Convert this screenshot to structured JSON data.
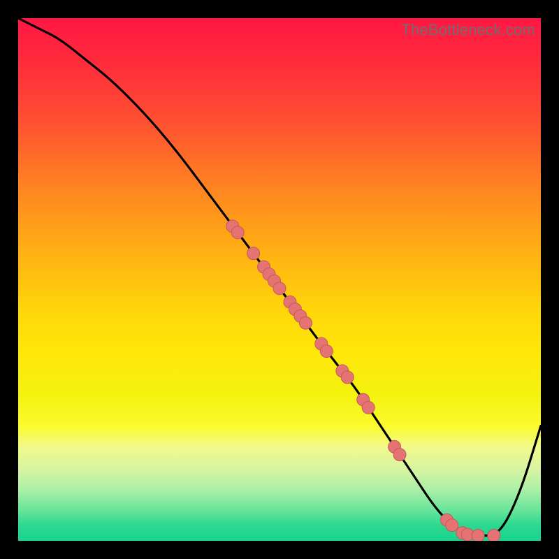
{
  "watermark": "TheBottleneck.com",
  "colors": {
    "curve_stroke": "#000000",
    "dot_fill": "#e57373",
    "dot_stroke": "#c25a5a"
  },
  "chart_data": {
    "type": "line",
    "title": "",
    "xlabel": "",
    "ylabel": "",
    "xlim": [
      0,
      100
    ],
    "ylim": [
      0,
      100
    ],
    "grid": false,
    "legend": false,
    "x": [
      0,
      4,
      8,
      13,
      18,
      24,
      30,
      36,
      42,
      48,
      54,
      60,
      64,
      68,
      72,
      76,
      80,
      84,
      88,
      92,
      96,
      100
    ],
    "y": [
      100,
      98,
      96,
      92,
      88,
      82,
      75,
      67,
      59,
      51,
      43,
      35,
      30,
      24,
      18,
      12,
      6,
      2,
      1,
      1,
      9,
      22
    ],
    "markers": [
      {
        "x": 41,
        "y": 60.2
      },
      {
        "x": 42,
        "y": 59.0
      },
      {
        "x": 45,
        "y": 55.0
      },
      {
        "x": 47,
        "y": 52.4
      },
      {
        "x": 48,
        "y": 51.0
      },
      {
        "x": 49,
        "y": 49.7
      },
      {
        "x": 50,
        "y": 48.3
      },
      {
        "x": 52,
        "y": 45.7
      },
      {
        "x": 53,
        "y": 44.3
      },
      {
        "x": 54,
        "y": 43.0
      },
      {
        "x": 55,
        "y": 41.7
      },
      {
        "x": 58,
        "y": 37.7
      },
      {
        "x": 59,
        "y": 36.3
      },
      {
        "x": 62,
        "y": 32.5
      },
      {
        "x": 63,
        "y": 31.3
      },
      {
        "x": 66,
        "y": 27.0
      },
      {
        "x": 67,
        "y": 25.5
      },
      {
        "x": 72,
        "y": 18.0
      },
      {
        "x": 73,
        "y": 16.5
      },
      {
        "x": 82,
        "y": 4.0
      },
      {
        "x": 83,
        "y": 3.0
      },
      {
        "x": 85,
        "y": 1.5
      },
      {
        "x": 86,
        "y": 1.2
      },
      {
        "x": 88,
        "y": 1.0
      },
      {
        "x": 91,
        "y": 1.0
      }
    ]
  }
}
